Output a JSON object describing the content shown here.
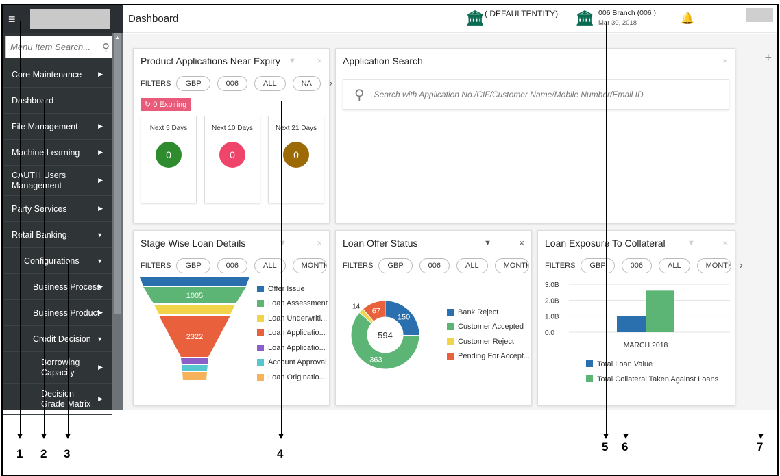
{
  "sidebar": {
    "menu_icon": "hamburger-icon",
    "search_placeholder": "Menu Item Search...",
    "items": [
      {
        "label": "Core Maintenance",
        "arrow": "▶"
      },
      {
        "label": "Dashboard",
        "arrow": ""
      },
      {
        "label": "File Management",
        "arrow": "▶"
      },
      {
        "label": "Machine Learning",
        "arrow": "▶"
      },
      {
        "label": "CAUTH Users Management",
        "arrow": "▶"
      },
      {
        "label": "Party Services",
        "arrow": "▶"
      },
      {
        "label": "Retail Banking",
        "arrow": "▼"
      },
      {
        "label": "Configurations",
        "arrow": "▼"
      },
      {
        "label": "Business Process",
        "arrow": "▶"
      },
      {
        "label": "Business Product",
        "arrow": "▶"
      },
      {
        "label": "Credit Decision",
        "arrow": "▼"
      },
      {
        "label": "Borrowing Capacity",
        "arrow": "▶"
      },
      {
        "label": "Decision Grade Matrix",
        "arrow": "▶"
      }
    ]
  },
  "header": {
    "title": "Dashboard",
    "entity": "( DEFAULTENTITY)",
    "branch": "006 Branch  (006 )",
    "date": "Mar 30, 2018"
  },
  "filters_label": "FILTERS",
  "expiry_card": {
    "title": "Product Applications Near Expiry",
    "filters": [
      "GBP",
      "006",
      "ALL",
      "NA"
    ],
    "expiring": "0 Expiring",
    "tiles": [
      {
        "label": "Next 5 Days",
        "value": "0",
        "color": "#2e8b2e"
      },
      {
        "label": "Next 10 Days",
        "value": "0",
        "color": "#f0456a"
      },
      {
        "label": "Next 21 Days",
        "value": "0",
        "color": "#9c6b07"
      }
    ]
  },
  "search_card": {
    "title": "Application Search",
    "placeholder": "Search with Application No./CIF/Customer Name/Mobile Number/Email ID"
  },
  "stage_card": {
    "title": "Stage Wise Loan Details",
    "filters": [
      "GBP",
      "006",
      "ALL",
      "MONTH"
    ],
    "legend": [
      "Offer Issue",
      "Loan Assessment",
      "Loan Underwriti...",
      "Loan Applicatio...",
      "Loan Applicatio...",
      "Account Approval",
      "Loan Originatio..."
    ],
    "colors": [
      "#2a6fae",
      "#5cb574",
      "#f2d44b",
      "#e9603d",
      "#8a5fc8",
      "#57c7cf",
      "#f7b25a"
    ]
  },
  "offer_card": {
    "title": "Loan Offer Status",
    "filters": [
      "GBP",
      "006",
      "ALL",
      "MONTH"
    ],
    "legend": [
      "Bank Reject",
      "Customer Accepted",
      "Customer Reject",
      "Pending For Accept..."
    ],
    "colors": [
      "#2a6fae",
      "#5cb574",
      "#f2d44b",
      "#e9603d"
    ]
  },
  "exposure_card": {
    "title": "Loan Exposure To Collateral",
    "filters": [
      "GBP",
      "006",
      "ALL",
      "MONTH"
    ]
  },
  "chart_data": [
    {
      "type": "funnel",
      "title": "Stage Wise Loan Details",
      "categories": [
        "Offer Issue",
        "Loan Assessment",
        "Loan Underwriti...",
        "Loan Applicatio...",
        "Loan Applicatio...",
        "Account Approval",
        "Loan Originatio..."
      ],
      "data_labels": [
        "",
        "1005",
        "",
        "2322",
        "",
        "",
        ""
      ]
    },
    {
      "type": "pie",
      "title": "Loan Offer Status",
      "categories": [
        "Bank Reject",
        "Customer Accepted",
        "Customer Reject",
        "Pending For Accept..."
      ],
      "values": [
        150,
        363,
        14,
        67
      ],
      "center_label": "594"
    },
    {
      "type": "bar",
      "title": "Loan Exposure To Collateral",
      "categories": [
        "MARCH 2018"
      ],
      "series": [
        {
          "name": "Total Loan Value",
          "values": [
            1.0
          ],
          "color": "#2a6fae"
        },
        {
          "name": "Total Collateral Taken Against Loans",
          "values": [
            2.6
          ],
          "color": "#5cb574"
        }
      ],
      "yticks": [
        "3.0B",
        "2.0B",
        "1.0B",
        "0.0"
      ],
      "ylim": [
        0,
        3.0
      ]
    }
  ],
  "annotations": [
    "1",
    "2",
    "3",
    "4",
    "5",
    "6",
    "7"
  ]
}
